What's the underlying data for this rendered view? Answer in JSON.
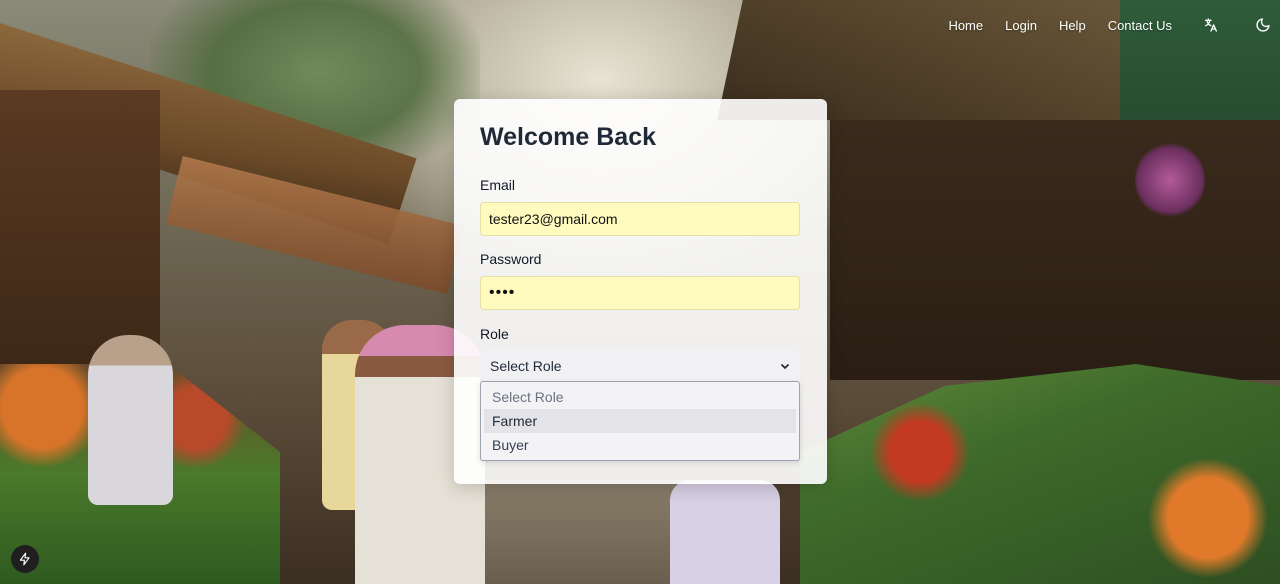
{
  "nav": {
    "links": [
      "Home",
      "Login",
      "Help",
      "Contact Us"
    ],
    "icons": [
      "translate-icon",
      "moon-icon"
    ]
  },
  "login": {
    "title": "Welcome Back",
    "email_label": "Email",
    "email_value": "tester23@gmail.com",
    "password_label": "Password",
    "password_value": "1234",
    "role_label": "Role",
    "role_selected": "Select Role",
    "role_options": [
      "Select Role",
      "Farmer",
      "Buyer"
    ]
  },
  "colors": {
    "autofill_bg": "#fffbbf",
    "title": "#1f2937",
    "card_bg": "rgba(255,255,255,0.91)"
  },
  "corner_icon": "bolt-icon"
}
